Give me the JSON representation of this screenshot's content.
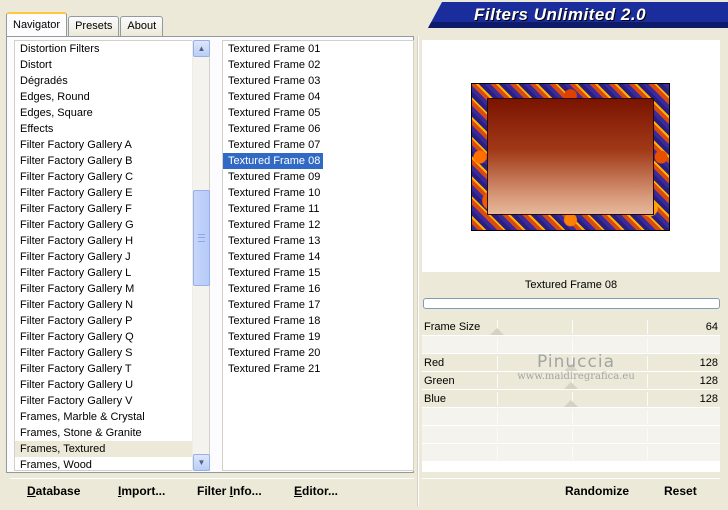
{
  "tabs": [
    {
      "label": "Navigator",
      "active": true
    },
    {
      "label": "Presets",
      "active": false
    },
    {
      "label": "About",
      "active": false
    }
  ],
  "header": {
    "title": "Filters Unlimited 2.0"
  },
  "categories": [
    "Distortion Filters",
    "Distort",
    "Dégradés",
    "Edges, Round",
    "Edges, Square",
    "Effects",
    "Filter Factory Gallery A",
    "Filter Factory Gallery B",
    "Filter Factory Gallery C",
    "Filter Factory Gallery E",
    "Filter Factory Gallery F",
    "Filter Factory Gallery G",
    "Filter Factory Gallery H",
    "Filter Factory Gallery J",
    "Filter Factory Gallery L",
    "Filter Factory Gallery M",
    "Filter Factory Gallery N",
    "Filter Factory Gallery P",
    "Filter Factory Gallery Q",
    "Filter Factory Gallery S",
    "Filter Factory Gallery T",
    "Filter Factory Gallery U",
    "Filter Factory Gallery V",
    "Frames, Marble & Crystal",
    "Frames, Stone & Granite",
    "Frames, Textured",
    "Frames, Wood"
  ],
  "selected_category": "Frames, Textured",
  "filters": [
    "Textured Frame 01",
    "Textured Frame 02",
    "Textured Frame 03",
    "Textured Frame 04",
    "Textured Frame 05",
    "Textured Frame 06",
    "Textured Frame 07",
    "Textured Frame 08",
    "Textured Frame 09",
    "Textured Frame 10",
    "Textured Frame 11",
    "Textured Frame 12",
    "Textured Frame 13",
    "Textured Frame 14",
    "Textured Frame 15",
    "Textured Frame 16",
    "Textured Frame 17",
    "Textured Frame 18",
    "Textured Frame 19",
    "Textured Frame 20",
    "Textured Frame 21"
  ],
  "selected_filter": "Textured Frame 08",
  "preview": {
    "filter_name": "Textured Frame 08"
  },
  "params": [
    {
      "label": "Frame Size",
      "value": "64",
      "level": 0.25
    },
    {
      "label": "Red",
      "value": "128",
      "level": 0.5
    },
    {
      "label": "Green",
      "value": "128",
      "level": 0.5
    },
    {
      "label": "Blue",
      "value": "128",
      "level": 0.5
    }
  ],
  "watermark": {
    "name": "Pinuccia",
    "url": "www.maidiregrafica.eu"
  },
  "buttons": {
    "database": "Database",
    "import": "Import...",
    "filter_info": "Filter Info...",
    "editor": "Editor...",
    "randomize": "Randomize",
    "reset": "Reset"
  }
}
